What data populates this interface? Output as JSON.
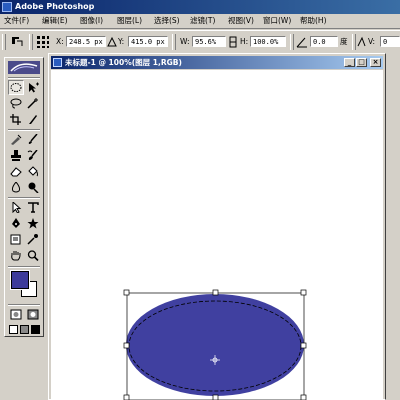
{
  "app": {
    "title": "Adobe Photoshop"
  },
  "menu": [
    {
      "label": "文件(F)"
    },
    {
      "label": "编辑(E)"
    },
    {
      "label": "图像(I)"
    },
    {
      "label": "图层(L)"
    },
    {
      "label": "选择(S)"
    },
    {
      "label": "滤镜(T)"
    },
    {
      "label": "视图(V)"
    },
    {
      "label": "窗口(W)"
    },
    {
      "label": "帮助(H)"
    }
  ],
  "options": {
    "x_label": "X:",
    "x_value": "248.5 px",
    "y_label": "Y:",
    "y_value": "415.0 px",
    "w_label": "W:",
    "w_value": "95.6%",
    "h_label": "H:",
    "h_value": "100.0%",
    "angle_value": "0.0",
    "angle_unit": "度",
    "skew_label": "V:",
    "skew_value": "0"
  },
  "document": {
    "title": "未标题-1 @ 100%(图层 1,RGB)"
  },
  "colors": {
    "foreground": "#3d3b9a",
    "background": "#ffffff",
    "ellipse": "#4040a0",
    "titlebar": "#0a246a"
  },
  "tools": [
    "marquee-icon",
    "move-icon",
    "lasso-icon",
    "magic-wand-icon",
    "crop-icon",
    "slice-icon",
    "healing-brush-icon",
    "brush-icon",
    "clone-stamp-icon",
    "history-brush-icon",
    "eraser-icon",
    "paint-bucket-icon",
    "blur-icon",
    "dodge-icon",
    "path-select-icon",
    "type-icon",
    "pen-icon",
    "custom-shape-icon",
    "notes-icon",
    "eyedropper-icon",
    "hand-icon",
    "zoom-icon"
  ]
}
